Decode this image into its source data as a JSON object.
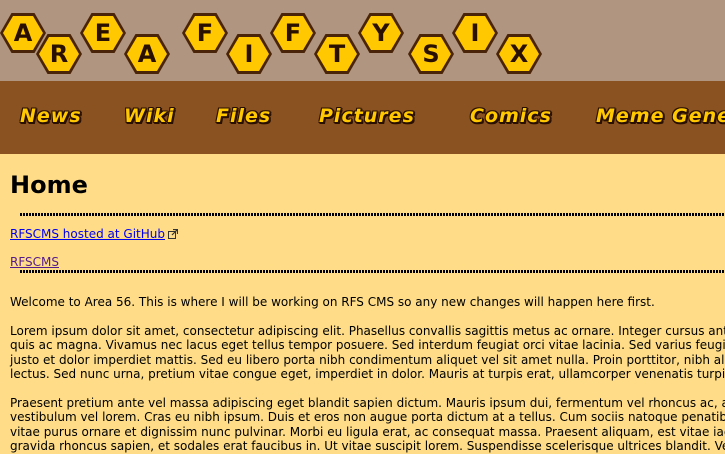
{
  "logo": {
    "row1": [
      "A",
      "R",
      "E",
      "A",
      "F",
      "I",
      "F",
      "T",
      "Y",
      "S",
      "I",
      "X"
    ]
  },
  "nav": {
    "items": [
      "News",
      "Wiki",
      "Files",
      "Pictures",
      "Comics",
      "Meme Generator"
    ]
  },
  "page": {
    "title": "Home",
    "links": {
      "github": "RFSCMS hosted at GitHub",
      "rfscms": "RFSCMS"
    },
    "welcome": "Welcome to Area 56. This is where I will be working on RFS CMS so any new changes will happen here first.",
    "para1": [
      "Lorem ipsum dolor sit amet, consectetur adipiscing elit. Phasellus convallis sagittis metus ac ornare. Integer cursus ante",
      "quis ac magna. Vivamus nec lacus eget tellus tempor posuere. Sed interdum feugiat orci vitae lacinia. Sed varius feugiat",
      "justo et dolor imperdiet mattis. Sed eu libero porta nibh condimentum aliquet vel sit amet nulla. Proin porttitor, nibh alic",
      "lectus. Sed nunc urna, pretium vitae congue eget, imperdiet in dolor. Mauris at turpis erat, ullamcorper venenatis turpis"
    ],
    "para2": [
      "Praesent pretium ante vel massa adipiscing eget blandit sapien dictum. Mauris ipsum dui, fermentum vel rhoncus ac, ali",
      "vestibulum vel lorem. Cras eu nibh ipsum. Duis et eros non augue porta dictum at a tellus. Cum sociis natoque penatibu",
      "vitae purus ornare et dignissim nunc pulvinar. Morbi eu ligula erat, ac consequat massa. Praesent aliquam, est vitae iacu",
      "gravida rhoncus sapien, et sodales erat faucibus in. Ut vitae suscipit lorem. Suspendisse scelerisque ultrices blandit. Vest"
    ]
  },
  "colors": {
    "banner_bg": "#b09580",
    "nav_bg": "#8a5220",
    "page_bg": "#ffdd88",
    "hex_fill": "#ffc800",
    "hex_outline": "#4a2408"
  },
  "icons": {
    "external": "external-link-icon"
  }
}
